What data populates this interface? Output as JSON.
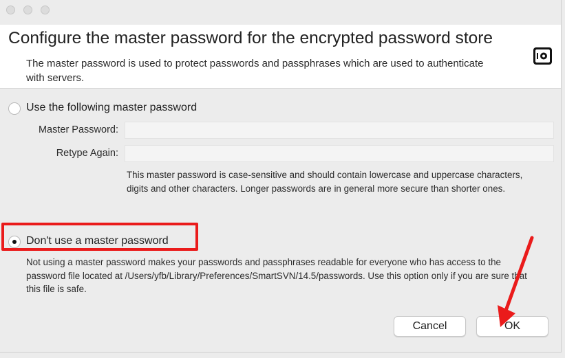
{
  "header": {
    "title": "Configure the master password for the encrypted password store",
    "description": "The master password is used to protect passwords and passphrases which are used to authenticate with servers."
  },
  "option_use": {
    "label": "Use the following master password",
    "master_password_label": "Master Password:",
    "master_password_value": "",
    "retype_label": "Retype Again:",
    "retype_value": "",
    "hint": "This master password is case-sensitive and should contain lowercase and uppercase characters, digits and other characters. Longer passwords are in general more secure than shorter ones.",
    "selected": false
  },
  "option_none": {
    "label": "Don't use a master password",
    "hint": "Not using a master password makes your passwords and passphrases readable for everyone who has access to the password file located at /Users/yfb/Library/Preferences/SmartSVN/14.5/passwords. Use this option only if you are sure that this file is safe.",
    "selected": true
  },
  "buttons": {
    "cancel": "Cancel",
    "ok": "OK"
  },
  "colors": {
    "annotation": "#ea1b1b",
    "header_bg": "#ffffff",
    "dialog_bg": "#ececec"
  },
  "icons": {
    "header": "safe-icon",
    "window_controls": [
      "close-window-icon",
      "minimize-window-icon",
      "zoom-window-icon"
    ]
  }
}
